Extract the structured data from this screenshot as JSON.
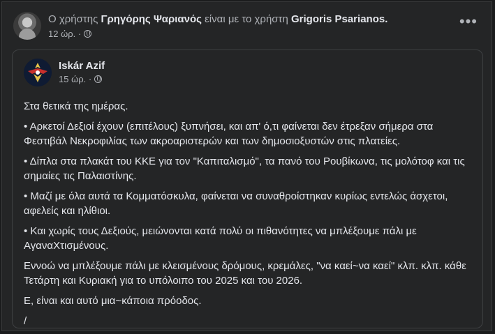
{
  "header": {
    "prefix": "Ο χρήστης",
    "author": "Γρηγόρης Ψαριανός",
    "middle": "είναι με το χρήστη",
    "with_user": "Grigoris Psarianos.",
    "time": "12 ώρ. ·",
    "more_label": "•••"
  },
  "shared_post": {
    "author": "Iskár Azif",
    "time": "15 ώρ. ·",
    "paragraphs": [
      "Στα θετικά της ημέρας.",
      "• Αρκετοί Δεξιοί έχουν (επιτέλους) ξυπνήσει, και απ' ό,τι φαίνεται δεν έτρεξαν σήμερα στα Φεστιβάλ Νεκροφιλίας των ακροαριστερών και των δημοσιοξυστών στις πλατείες.",
      "• Δίπλα στα πλακάτ του ΚΚΕ για τον \"Καπιταλισμό\", τα πανό του Ρουβίκωνα, τις μολότοφ και τις σημαίες τις Παλαιστίνης.",
      "• Μαζί με όλα αυτά τα Κομματόσκυλα, φαίνεται να συναθροίστηκαν κυρίως εντελώς άσχετοι, αφελείς και ηλίθιοι.",
      "• Και χωρίς τους Δεξιούς, μειώνονται κατά πολύ οι πιθανότητες να μπλέξουμε πάλι με ΑγαναΧτισμένους.",
      "Εννοώ να μπλέξουμε πάλι με κλεισμένους δρόμους, κρεμάλες, \"να καεί~να καεί\" κλπ. κλπ. κάθε Τετάρτη και Κυριακή για το υπόλοιπο του 2025 και του 2026.",
      "Ε, είναι και αυτό μια~κάποια πρόοδος.",
      "/"
    ]
  },
  "icons": {
    "privacy": "globe-icon",
    "menu": "more-options-icon"
  }
}
